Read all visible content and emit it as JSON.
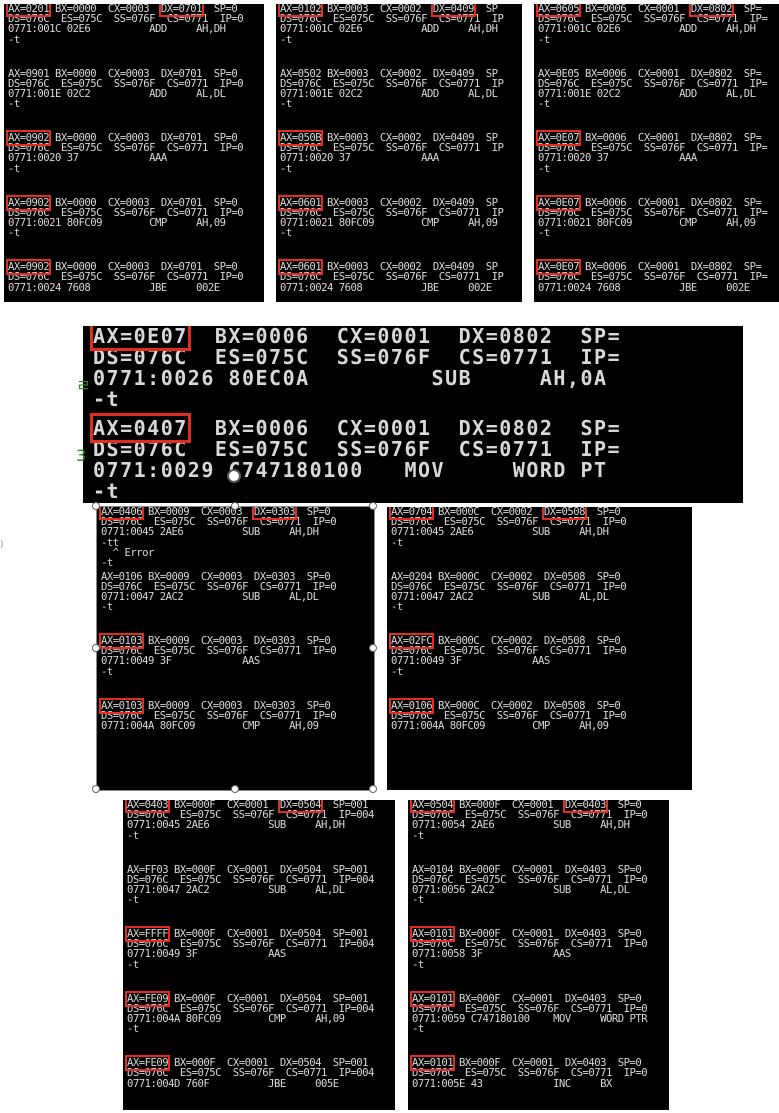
{
  "panels": [
    {
      "id": "p1",
      "blocks": [
        {
          "l1": [
            "AX=0201",
            " BX=0000  CX=0003  ",
            "DX=0701",
            "  SP=0"
          ],
          "hl": [
            0,
            2
          ],
          "l2": "DS=076C  ES=075C  SS=076F  CS=0771  IP=0",
          "l3": "0771:001C 02E6          ADD     AH,DH",
          "l4": "-t"
        },
        {
          "l1": [
            "AX=0901",
            " BX=0000  CX=0003  ",
            "DX=0701",
            "  SP=0"
          ],
          "hl": [],
          "l2": "DS=076C  ES=075C  SS=076F  CS=0771  IP=0",
          "l3": "0771:001E 02C2          ADD     AL,DL",
          "l4": "-t"
        },
        {
          "l1": [
            "AX=0902",
            " BX=0000  CX=0003  ",
            "DX=0701",
            "  SP=0"
          ],
          "hl": [
            0
          ],
          "l2": "DS=076C  ES=075C  SS=076F  CS=0771  IP=0",
          "l3": "0771:0020 37            AAA",
          "l4": "-t"
        },
        {
          "l1": [
            "AX=0902",
            " BX=0000  CX=0003  ",
            "DX=0701",
            "  SP=0"
          ],
          "hl": [
            0
          ],
          "l2": "DS=076C  ES=075C  SS=076F  CS=0771  IP=0",
          "l3": "0771:0021 80FC09        CMP     AH,09",
          "l4": "-t"
        },
        {
          "l1": [
            "AX=0902",
            " BX=0000  CX=0003  ",
            "DX=0701",
            "  SP=0"
          ],
          "hl": [
            0
          ],
          "l2": "DS=076C  ES=075C  SS=076F  CS=0771  IP=0",
          "l3": "0771:0024 7608          JBE     002E",
          "l4": ""
        }
      ]
    },
    {
      "id": "p2",
      "blocks": [
        {
          "l1": [
            "AX=0102",
            " BX=0003  CX=0002  ",
            "DX=0409",
            "  SP"
          ],
          "hl": [
            0,
            2
          ],
          "l2": "DS=076C  ES=075C  SS=076F  CS=0771  IP",
          "l3": "0771:001C 02E6          ADD     AH,DH",
          "l4": "-t"
        },
        {
          "l1": [
            "AX=0502",
            " BX=0003  CX=0002  ",
            "DX=0409",
            "  SP"
          ],
          "hl": [],
          "l2": "DS=076C  ES=075C  SS=076F  CS=0771  IP",
          "l3": "0771:001E 02C2          ADD     AL,DL",
          "l4": "-t"
        },
        {
          "l1": [
            "AX=050B",
            " BX=0003  CX=0002  ",
            "DX=0409",
            "  SP"
          ],
          "hl": [
            0
          ],
          "l2": "DS=076C  ES=075C  SS=076F  CS=0771  IP",
          "l3": "0771:0020 37            AAA",
          "l4": "-t"
        },
        {
          "l1": [
            "AX=0601",
            " BX=0003  CX=0002  ",
            "DX=0409",
            "  SP"
          ],
          "hl": [
            0
          ],
          "l2": "DS=076C  ES=075C  SS=076F  CS=0771  IP",
          "l3": "0771:0021 80FC09        CMP     AH,09",
          "l4": "-t"
        },
        {
          "l1": [
            "AX=0601",
            " BX=0003  CX=0002  ",
            "DX=0409",
            "  SP"
          ],
          "hl": [
            0
          ],
          "l2": "DS=076C  ES=075C  SS=076F  CS=0771  IP",
          "l3": "0771:0024 7608          JBE     002E",
          "l4": ""
        }
      ]
    },
    {
      "id": "p3",
      "blocks": [
        {
          "l1": [
            "AX=0605",
            " BX=0006  CX=0001  ",
            "DX=0802",
            "  SP="
          ],
          "hl": [
            0,
            2
          ],
          "l2": "DS=076C  ES=075C  SS=076F  CS=0771  IP=",
          "l3": "0771:001C 02E6          ADD     AH,DH",
          "l4": "-t"
        },
        {
          "l1": [
            "AX=0E05",
            " BX=0006  CX=0001  ",
            "DX=0802",
            "  SP="
          ],
          "hl": [],
          "l2": "DS=076C  ES=075C  SS=076F  CS=0771  IP=",
          "l3": "0771:001E 02C2          ADD     AL,DL",
          "l4": "-t"
        },
        {
          "l1": [
            "AX=0E07",
            " BX=0006  CX=0001  ",
            "DX=0802",
            "  SP="
          ],
          "hl": [
            0
          ],
          "l2": "DS=076C  ES=075C  SS=076F  CS=0771  IP=",
          "l3": "0771:0020 37            AAA",
          "l4": "-t"
        },
        {
          "l1": [
            "AX=0E07",
            " BX=0006  CX=0001  ",
            "DX=0802",
            "  SP="
          ],
          "hl": [
            0
          ],
          "l2": "DS=076C  ES=075C  SS=076F  CS=0771  IP=",
          "l3": "0771:0021 80FC09        CMP     AH,09",
          "l4": "-t"
        },
        {
          "l1": [
            "AX=0E07",
            " BX=0006  CX=0001  ",
            "DX=0802",
            "  SP="
          ],
          "hl": [
            0
          ],
          "l2": "DS=076C  ES=075C  SS=076F  CS=0771  IP=",
          "l3": "0771:0024 7608          JBE     002E",
          "l4": ""
        }
      ]
    },
    {
      "id": "p4",
      "blocks": [
        {
          "l1": [
            "AX=0E07",
            "  BX=0006  CX=0001  ",
            "DX=0802",
            "  SP="
          ],
          "hl": [
            0
          ],
          "l2": "DS=076C  ES=075C  SS=076F  CS=0771  IP=",
          "l3": "0771:0026 80EC0A         SUB     AH,0A",
          "l4": "-t"
        },
        {
          "l1": [
            "AX=0407",
            "  BX=0006  CX=0001  ",
            "DX=0802",
            "  SP="
          ],
          "hl": [
            0
          ],
          "l2": "DS=076C  ES=075C  SS=076F  CS=0771  IP=",
          "l3": "0771:0029 C747180100   MOV     WORD PT",
          "l4": "-t"
        }
      ]
    },
    {
      "id": "p5",
      "blocks": [
        {
          "l1": [
            "AX=0406",
            " BX=0009  CX=0003  ",
            "DX=0303",
            "  SP=0"
          ],
          "hl": [
            0,
            2
          ],
          "l2": "DS=076C  ES=075C  SS=076F  CS=0771  IP=0",
          "l3": "0771:0045 2AE6          SUB     AH,DH",
          "l4": "-tt\n  ^ Error\n-t"
        },
        {
          "l1": [
            "AX=0106",
            " BX=0009  CX=0003  ",
            "DX=0303",
            "  SP=0"
          ],
          "hl": [],
          "l2": "DS=076C  ES=075C  SS=076F  CS=0771  IP=0",
          "l3": "0771:0047 2AC2          SUB     AL,DL",
          "l4": "-t"
        },
        {
          "l1": [
            "AX=0103",
            " BX=0009  CX=0003  ",
            "DX=0303",
            "  SP=0"
          ],
          "hl": [
            0
          ],
          "l2": "DS=076C  ES=075C  SS=076F  CS=0771  IP=0",
          "l3": "0771:0049 3F            AAS",
          "l4": "-t"
        },
        {
          "l1": [
            "AX=0103",
            " BX=0009  CX=0003  ",
            "DX=0303",
            "  SP=0"
          ],
          "hl": [
            0
          ],
          "l2": "DS=076C  ES=075C  SS=076F  CS=0771  IP=0",
          "l3": "0771:004A 80FC09        CMP     AH,09",
          "l4": ""
        }
      ]
    },
    {
      "id": "p6",
      "blocks": [
        {
          "l1": [
            "AX=0704",
            " BX=000C  CX=0002  ",
            "DX=0508",
            "  SP=0"
          ],
          "hl": [
            0,
            2
          ],
          "l2": "DS=076C  ES=075C  SS=076F  CS=0771  IP=0",
          "l3": "0771:0045 2AE6          SUB     AH,DH",
          "l4": "-t"
        },
        {
          "l1": [
            "AX=0204",
            " BX=000C  CX=0002  ",
            "DX=0508",
            "  SP=0"
          ],
          "hl": [],
          "l2": "DS=076C  ES=075C  SS=076F  CS=0771  IP=0",
          "l3": "0771:0047 2AC2          SUB     AL,DL",
          "l4": "-t"
        },
        {
          "l1": [
            "AX=02FC",
            " BX=000C  CX=0002  ",
            "DX=0508",
            "  SP=0"
          ],
          "hl": [
            0
          ],
          "l2": "DS=076C  ES=075C  SS=076F  CS=0771  IP=0",
          "l3": "0771:0049 3F            AAS",
          "l4": "-t"
        },
        {
          "l1": [
            "AX=0106",
            " BX=000C  CX=0002  ",
            "DX=0508",
            "  SP=0"
          ],
          "hl": [
            0
          ],
          "l2": "DS=076C  ES=075C  SS=076F  CS=0771  IP=0",
          "l3": "0771:004A 80FC09        CMP     AH,09",
          "l4": ""
        }
      ]
    },
    {
      "id": "p7",
      "blocks": [
        {
          "l1": [
            "AX=0403",
            " BX=000F  CX=0001  ",
            "DX=0504",
            "  SP=001"
          ],
          "hl": [
            0,
            2
          ],
          "l2": "DS=076C  ES=075C  SS=076F  CS=0771  IP=004",
          "l3": "0771:0045 2AE6          SUB     AH,DH",
          "l4": "-t"
        },
        {
          "l1": [
            "AX=FF03",
            " BX=000F  CX=0001  ",
            "DX=0504",
            "  SP=001"
          ],
          "hl": [],
          "l2": "DS=076C  ES=075C  SS=076F  CS=0771  IP=004",
          "l3": "0771:0047 2AC2          SUB     AL,DL",
          "l4": "-t"
        },
        {
          "l1": [
            "AX=FFFF",
            " BX=000F  CX=0001  ",
            "DX=0504",
            "  SP=001"
          ],
          "hl": [
            0
          ],
          "l2": "DS=076C  ES=075C  SS=076F  CS=0771  IP=004",
          "l3": "0771:0049 3F            AAS",
          "l4": "-t"
        },
        {
          "l1": [
            "AX=FE09",
            " BX=000F  CX=0001  ",
            "DX=0504",
            "  SP=001"
          ],
          "hl": [
            0
          ],
          "l2": "DS=076C  ES=075C  SS=076F  CS=0771  IP=004",
          "l3": "0771:004A 80FC09        CMP     AH,09",
          "l4": "-t"
        },
        {
          "l1": [
            "AX=FE09",
            " BX=000F  CX=0001  ",
            "DX=0504",
            "  SP=001"
          ],
          "hl": [
            0
          ],
          "l2": "DS=076C  ES=075C  SS=076F  CS=0771  IP=004",
          "l3": "0771:004D 760F          JBE     005E",
          "l4": ""
        }
      ]
    },
    {
      "id": "p8",
      "blocks": [
        {
          "l1": [
            "AX=0504",
            " BX=000F  CX=0001  ",
            "DX=0403",
            "  SP=0"
          ],
          "hl": [
            0,
            2
          ],
          "l2": "DS=076C  ES=075C  SS=076F  CS=0771  IP=0",
          "l3": "0771:0054 2AE6          SUB     AH,DH",
          "l4": "-t"
        },
        {
          "l1": [
            "AX=0104",
            " BX=000F  CX=0001  ",
            "DX=0403",
            "  SP=0"
          ],
          "hl": [],
          "l2": "DS=076C  ES=075C  SS=076F  CS=0771  IP=0",
          "l3": "0771:0056 2AC2          SUB     AL,DL",
          "l4": "-t"
        },
        {
          "l1": [
            "AX=0101",
            " BX=000F  CX=0001  ",
            "DX=0403",
            "  SP=0"
          ],
          "hl": [
            0
          ],
          "l2": "DS=076C  ES=075C  SS=076F  CS=0771  IP=0",
          "l3": "0771:0058 3F            AAS",
          "l4": "-t"
        },
        {
          "l1": [
            "AX=0101",
            " BX=000F  CX=0001  ",
            "DX=0403",
            "  SP=0"
          ],
          "hl": [
            0
          ],
          "l2": "DS=076C  ES=075C  SS=076F  CS=0771  IP=0",
          "l3": "0771:0059 C747180100    MOV     WORD PTR",
          "l4": "-t"
        },
        {
          "l1": [
            "AX=0101",
            " BX=000F  CX=0001  ",
            "DX=0403",
            "  SP=0"
          ],
          "hl": [
            0
          ],
          "l2": "DS=076C  ES=075C  SS=076F  CS=0771  IP=0",
          "l3": "0771:005E 43            INC     BX",
          "l4": ""
        }
      ]
    }
  ],
  "colors": {
    "highlight": "#e32b1e",
    "terminal_bg": "#000000",
    "terminal_fg": "#d8d8d8"
  }
}
